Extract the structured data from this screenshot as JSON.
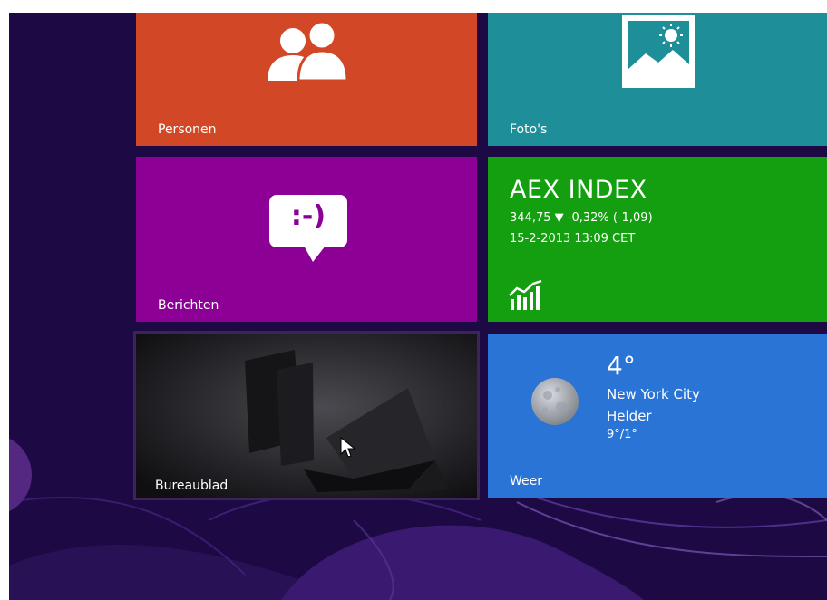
{
  "colors": {
    "background": "#1d0a45",
    "personen": "#d24726",
    "fotos": "#1e8e98",
    "berichten": "#8c0095",
    "finance": "#139f0f",
    "desktop": "#301a4c",
    "weer": "#2a74d6"
  },
  "tiles": {
    "personen": {
      "label": "Personen",
      "icon": "people-icon"
    },
    "fotos": {
      "label": "Foto's",
      "icon": "photo-icon"
    },
    "berichten": {
      "label": "Berichten",
      "icon": "message-smiley-icon",
      "icon_text": ":-)"
    },
    "finance": {
      "title": "AEX INDEX",
      "quote": "344,75 ▼ -0,32% (-1,09)",
      "datetime": "15-2-2013 13:09 CET",
      "icon": "finance-chart-icon"
    },
    "desktop": {
      "label": "Bureaublad",
      "icon": "laptop-wallpaper"
    },
    "weer": {
      "temperature": "4°",
      "city": "New York City",
      "condition": "Helder",
      "range": "9°/1°",
      "label": "Weer",
      "icon": "moon-icon"
    }
  }
}
